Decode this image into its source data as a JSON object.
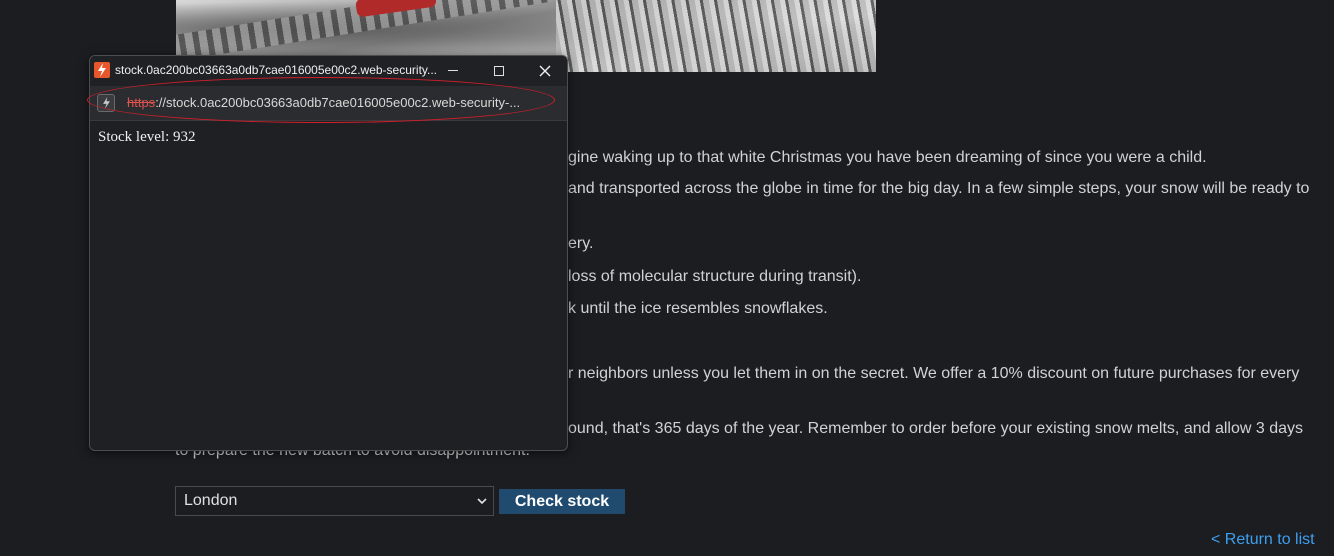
{
  "description": {
    "lines": [
      "gine waking up to that white Christmas you have been dreaming of since you were a child.",
      "and transported across the globe in time for the big day. In a few simple steps, your snow will be ready to",
      "ery.",
      "loss of molecular structure during transit).",
      "k until the ice resembles snowflakes.",
      "r neighbors unless you let them in on the secret. We offer a 10% discount on future purchases for every",
      "ound, that's 365 days of the year. Remember to order before your existing snow melts, and allow 3 days",
      "to prepare the new batch to avoid disappointment."
    ]
  },
  "stock_form": {
    "store_selected": "London",
    "check_button_label": "Check stock"
  },
  "return_link": "< Return to list",
  "popup": {
    "window_title": "stock.0ac200bc03663a0db7cae016005e00c2.web-security...",
    "url_scheme": "https",
    "url_rest": "://stock.0ac200bc03663a0db7cae016005e00c2.web-security-...",
    "content": "Stock level: 932",
    "highlight_color": "#d01f2c"
  },
  "icons": {
    "app": "lightning-icon",
    "site": "lightning-icon",
    "minimize": "minimize-icon",
    "maximize": "maximize-icon",
    "close": "close-icon",
    "select": "chevron-down-icon"
  }
}
